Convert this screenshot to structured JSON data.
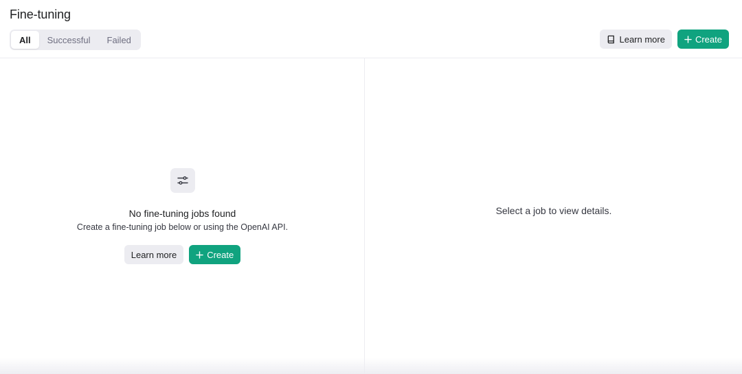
{
  "header": {
    "title": "Fine-tuning",
    "filters": [
      {
        "label": "All",
        "active": true
      },
      {
        "label": "Successful",
        "active": false
      },
      {
        "label": "Failed",
        "active": false
      }
    ],
    "learn_more_label": "Learn more",
    "create_label": "Create"
  },
  "empty_state": {
    "icon": "sliders-icon",
    "title": "No fine-tuning jobs found",
    "subtitle": "Create a fine-tuning job below or using the OpenAI API.",
    "learn_more_label": "Learn more",
    "create_label": "Create"
  },
  "details": {
    "placeholder": "Select a job to view details."
  },
  "colors": {
    "accent": "#10a37f",
    "gray_button": "#ececf1",
    "text": "#202123",
    "muted_text": "#6e6e80"
  }
}
